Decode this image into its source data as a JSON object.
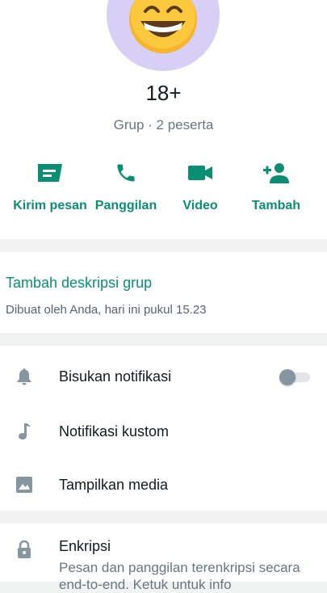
{
  "group": {
    "name": "18+",
    "subtitle": "Grup · 2 peserta"
  },
  "actions": [
    {
      "label": "Kirim pesan",
      "icon": "message-icon"
    },
    {
      "label": "Panggilan",
      "icon": "phone-icon"
    },
    {
      "label": "Video",
      "icon": "video-icon"
    },
    {
      "label": "Tambah",
      "icon": "add-person-icon"
    }
  ],
  "description": {
    "add_label": "Tambah deskripsi grup",
    "created": "Dibuat oleh Anda, hari ini pukul 15.23"
  },
  "settings": [
    {
      "label": "Bisukan notifikasi",
      "icon": "bell-icon",
      "toggle_on": false
    },
    {
      "label": "Notifikasi kustom",
      "icon": "music-note-icon"
    },
    {
      "label": "Tampilkan media",
      "icon": "image-icon"
    }
  ],
  "encryption": {
    "title": "Enkripsi",
    "description": "Pesan dan panggilan terenkripsi secara end-to-end. Ketuk untuk info"
  },
  "colors": {
    "accent": "#0a8f73",
    "icon_gray": "#8696a0",
    "avatar_bg": "#d7cff5"
  }
}
